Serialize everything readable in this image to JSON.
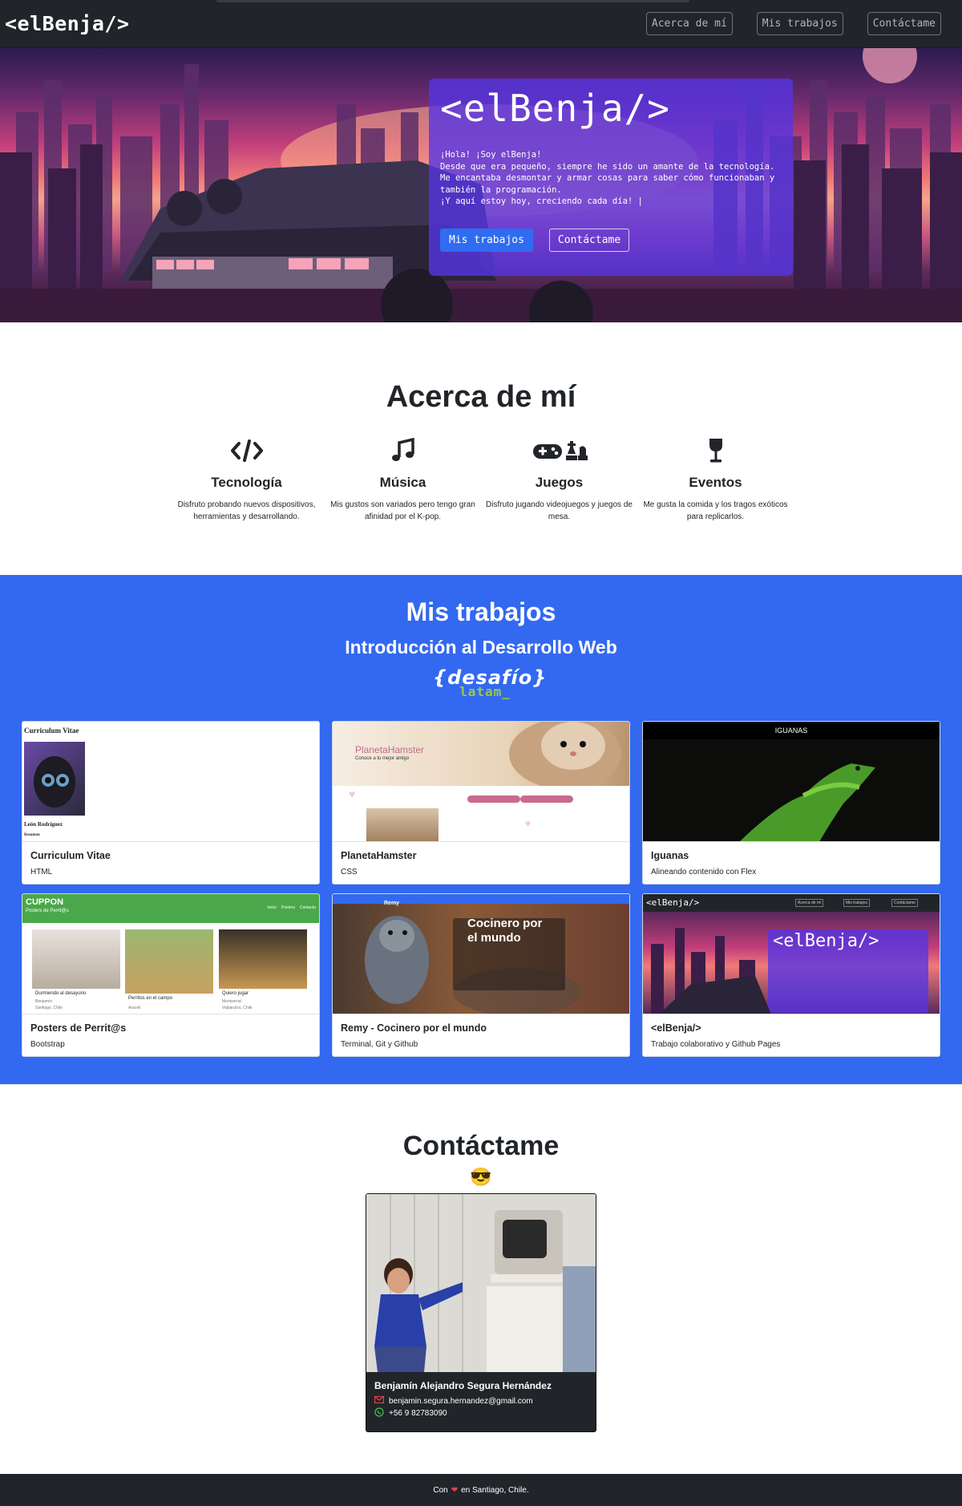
{
  "navbar": {
    "brand": "<elBenja/>",
    "links": [
      "Acerca de mí",
      "Mis trabajos",
      "Contáctame"
    ]
  },
  "hero": {
    "title": "<elBenja/>",
    "lines": [
      "¡Hola! ¡Soy elBenja!",
      "Desde que era pequeño, siempre he sido un amante de la tecnología.",
      "Me encantaba desmontar y armar cosas para saber cómo funcionaban y también la programación.",
      "¡Y aquí estoy hoy, creciendo cada día! |"
    ],
    "primary_button": "Mis trabajos",
    "secondary_button": "Contáctame"
  },
  "about": {
    "title": "Acerca de mí",
    "features": [
      {
        "icon": "code-icon",
        "title": "Tecnología",
        "text": "Disfruto probando nuevos dispositivos, herramientas y desarrollando."
      },
      {
        "icon": "music-icon",
        "title": "Música",
        "text": "Mis gustos son variados pero tengo gran afinidad por el K-pop."
      },
      {
        "icon": "gamepad-chess-icon",
        "title": "Juegos",
        "text": "Disfruto jugando videojuegos y juegos de mesa."
      },
      {
        "icon": "wine-glass-icon",
        "title": "Eventos",
        "text": "Me gusta la comida y los tragos exóticos para replicarlos."
      }
    ]
  },
  "works": {
    "title": "Mis trabajos",
    "subtitle": "Introducción al Desarrollo Web",
    "logo_top": "{desafío}",
    "logo_bottom": "latam_",
    "cards": [
      {
        "title": "Curriculum Vitae",
        "desc": "HTML",
        "thumb_heading": "Curriculum Vitae",
        "thumb_name": "León Rodríguez",
        "thumb_section": "Resumen"
      },
      {
        "title": "PlanetaHamster",
        "desc": "CSS",
        "thumb_heading": "PlanetaHamster",
        "thumb_sub": "Conoce a tu mejor amigo"
      },
      {
        "title": "Iguanas",
        "desc": "Alineando contenido con Flex",
        "thumb_heading": "IGUANAS"
      },
      {
        "title": "Posters de Perrit@s",
        "desc": "Bootstrap",
        "thumb_heading": "CUPPON",
        "thumb_sub": "Posters de Perrit@s",
        "thumb_nav": [
          "Inicio",
          "Posters",
          "Contacto"
        ],
        "thumb_captions": [
          "Durmiendo al desayuno",
          "Perritos en el campo",
          "Quiero jugar"
        ],
        "thumb_owners": [
          "Benjamín",
          "Araceli",
          "Montserrat"
        ],
        "thumb_places": [
          "Santiago, Chile",
          "Valparaíso, Chile"
        ]
      },
      {
        "title": "Remy - Cocinero por el mundo",
        "desc": "Terminal, Git y Github",
        "thumb_brand": "Remy",
        "thumb_heading": "Cocinero por el mundo"
      },
      {
        "title": "<elBenja/>",
        "desc": "Trabajo colaborativo y Github Pages",
        "thumb_brand": "<elBenja/>",
        "thumb_nav": [
          "Acerca de mí",
          "Mis trabajos",
          "Contáctame"
        ]
      }
    ]
  },
  "contact": {
    "title": "Contáctame",
    "emoji": "😎",
    "name": "Benjamín Alejandro Segura Hernández",
    "email": "benjamin.segura.hernandez@gmail.com",
    "phone": "+56 9 82783090"
  },
  "footer": {
    "prefix": "Con",
    "heart": "❤",
    "suffix": "en Santiago, Chile."
  },
  "colors": {
    "navbar": "#212529",
    "accent_blue": "#3369f0",
    "hero_card": "#5434e6"
  }
}
